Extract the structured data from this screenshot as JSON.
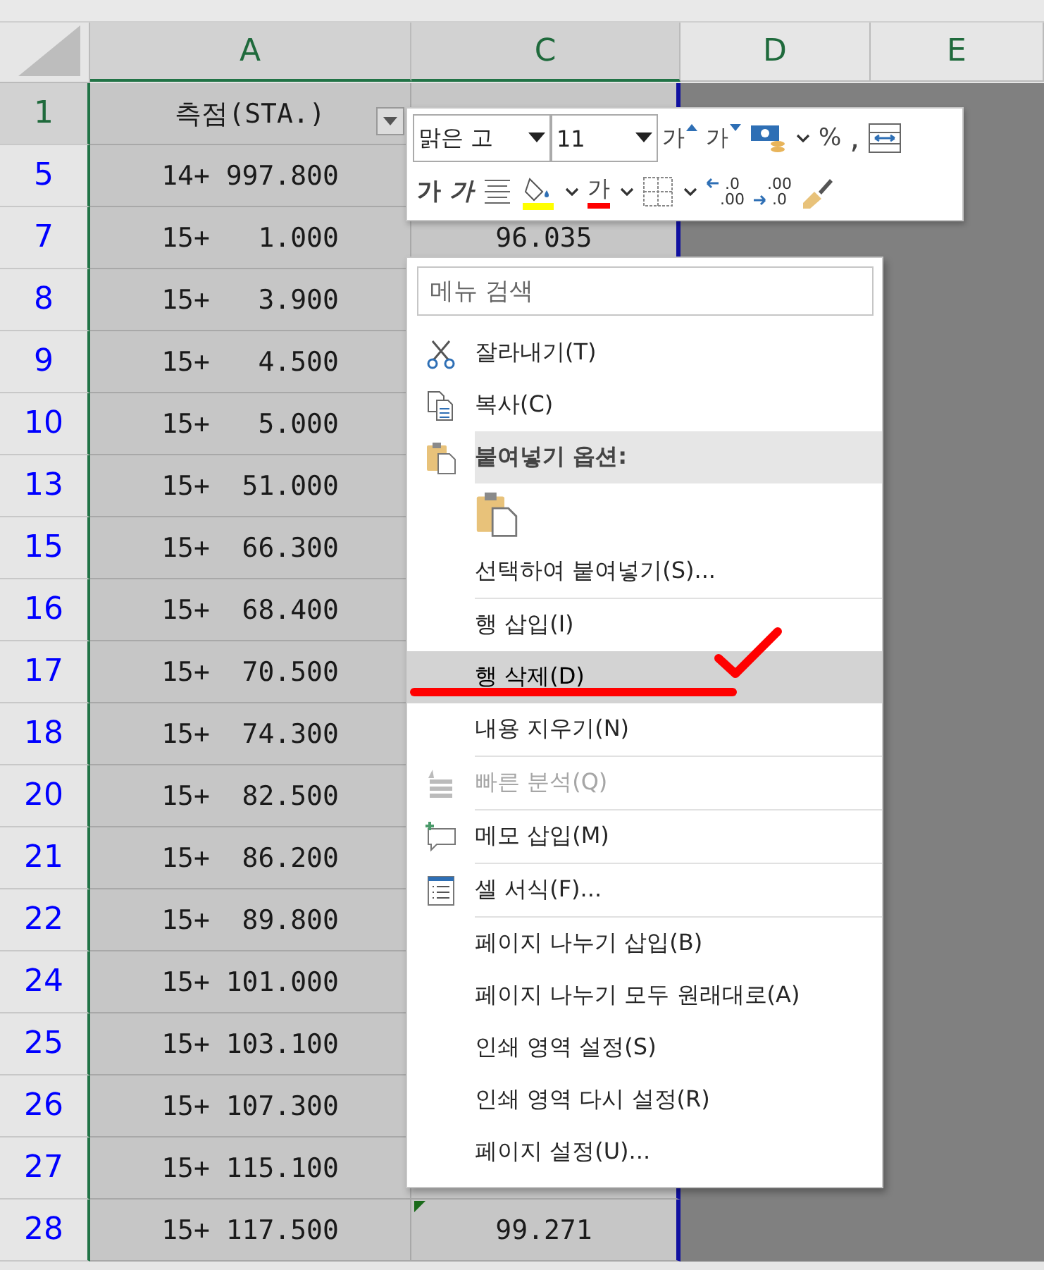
{
  "columns": [
    {
      "label": "A",
      "selected": true
    },
    {
      "label": "C",
      "selected": true
    },
    {
      "label": "D",
      "selected": false
    },
    {
      "label": "E",
      "selected": false
    }
  ],
  "rows": [
    {
      "number": "1",
      "station": "측점(STA.)",
      "kind": "header",
      "selected": true
    },
    {
      "number": "5",
      "station": "14+ 997.800",
      "kind": "data",
      "selected": false
    },
    {
      "number": "7",
      "station": "15+   1.000",
      "plan": "96.035",
      "kind": "data",
      "selected": false
    },
    {
      "number": "8",
      "station": "15+   3.900",
      "kind": "data",
      "selected": false
    },
    {
      "number": "9",
      "station": "15+   4.500",
      "kind": "data",
      "selected": false
    },
    {
      "number": "10",
      "station": "15+   5.000",
      "kind": "data",
      "selected": false
    },
    {
      "number": "13",
      "station": "15+  51.000",
      "kind": "data",
      "selected": false
    },
    {
      "number": "15",
      "station": "15+  66.300",
      "kind": "data",
      "selected": false
    },
    {
      "number": "16",
      "station": "15+  68.400",
      "kind": "data",
      "selected": false
    },
    {
      "number": "17",
      "station": "15+  70.500",
      "kind": "data",
      "selected": false
    },
    {
      "number": "18",
      "station": "15+  74.300",
      "kind": "data",
      "selected": false
    },
    {
      "number": "20",
      "station": "15+  82.500",
      "kind": "data",
      "selected": false
    },
    {
      "number": "21",
      "station": "15+  86.200",
      "kind": "data",
      "selected": false
    },
    {
      "number": "22",
      "station": "15+  89.800",
      "kind": "data",
      "selected": false
    },
    {
      "number": "24",
      "station": "15+ 101.000",
      "kind": "data",
      "selected": false
    },
    {
      "number": "25",
      "station": "15+ 103.100",
      "kind": "data",
      "selected": false
    },
    {
      "number": "26",
      "station": "15+ 107.300",
      "kind": "data",
      "selected": false
    },
    {
      "number": "27",
      "station": "15+ 115.100",
      "kind": "data",
      "selected": false
    },
    {
      "number": "28",
      "station": "15+ 117.500",
      "plan": "99.271",
      "kind": "data",
      "selected": false
    }
  ],
  "mini_toolbar": {
    "font": "맑은 고",
    "size": "11",
    "row_1": [
      {
        "kind": "grow",
        "text": "가",
        "dropdown": false
      },
      {
        "kind": "shrink",
        "text": "가",
        "dropdown": false
      },
      {
        "kind": "currency",
        "dropdown": true
      },
      {
        "kind": "percent",
        "text": "%",
        "dropdown": false
      },
      {
        "kind": "comma",
        "text": ",",
        "dropdown": false
      },
      {
        "kind": "merge",
        "dropdown": false
      }
    ],
    "row_2": [
      {
        "kind": "bold",
        "text": "가",
        "dropdown": false
      },
      {
        "kind": "italic",
        "text": "가",
        "dropdown": false
      },
      {
        "kind": "align",
        "dropdown": false
      },
      {
        "kind": "fill",
        "color": "#ffff00",
        "dropdown": true
      },
      {
        "kind": "fontcolor",
        "text": "가",
        "color": "#ff0000",
        "dropdown": true
      },
      {
        "kind": "borders",
        "dropdown": true
      },
      {
        "kind": "decimal",
        "top": ".0",
        "bottom": ".00",
        "dropdown": false
      },
      {
        "kind": "decimal",
        "top": ".00",
        "bottom": ".0",
        "dropdown": false
      },
      {
        "kind": "painter",
        "dropdown": false
      }
    ]
  },
  "context_menu": {
    "search_placeholder": "메뉴 검색",
    "items": [
      {
        "kind": "item",
        "label": "잘라내기(T)",
        "selected": false,
        "disabled": false
      },
      {
        "kind": "item",
        "label": "복사(C)",
        "selected": false,
        "disabled": false
      },
      {
        "kind": "header",
        "label": "붙여넣기 옵션:"
      },
      {
        "kind": "paste"
      },
      {
        "kind": "item",
        "label": "선택하여 붙여넣기(S)...",
        "selected": false,
        "disabled": false
      },
      {
        "kind": "separator"
      },
      {
        "kind": "item",
        "label": "행 삽입(I)",
        "selected": false,
        "disabled": false
      },
      {
        "kind": "item",
        "label": "행 삭제(D)",
        "selected": true,
        "disabled": false
      },
      {
        "kind": "item",
        "label": "내용 지우기(N)",
        "selected": false,
        "disabled": false
      },
      {
        "kind": "separator"
      },
      {
        "kind": "item",
        "label": "빠른 분석(Q)",
        "selected": false,
        "disabled": true
      },
      {
        "kind": "separator"
      },
      {
        "kind": "item",
        "label": "메모 삽입(M)",
        "selected": false,
        "disabled": false
      },
      {
        "kind": "separator"
      },
      {
        "kind": "item",
        "label": "셀 서식(F)...",
        "selected": false,
        "disabled": false
      },
      {
        "kind": "separator"
      },
      {
        "kind": "item",
        "label": "페이지 나누기 삽입(B)",
        "selected": false,
        "disabled": false
      },
      {
        "kind": "item",
        "label": "페이지 나누기 모두 원래대로(A)",
        "selected": false,
        "disabled": false
      },
      {
        "kind": "item",
        "label": "인쇄 영역 설정(S)",
        "selected": false,
        "disabled": false
      },
      {
        "kind": "item",
        "label": "인쇄 영역 다시 설정(R)",
        "selected": false,
        "disabled": false
      },
      {
        "kind": "item",
        "label": "페이지 설정(U)...",
        "selected": false,
        "disabled": false
      }
    ]
  }
}
